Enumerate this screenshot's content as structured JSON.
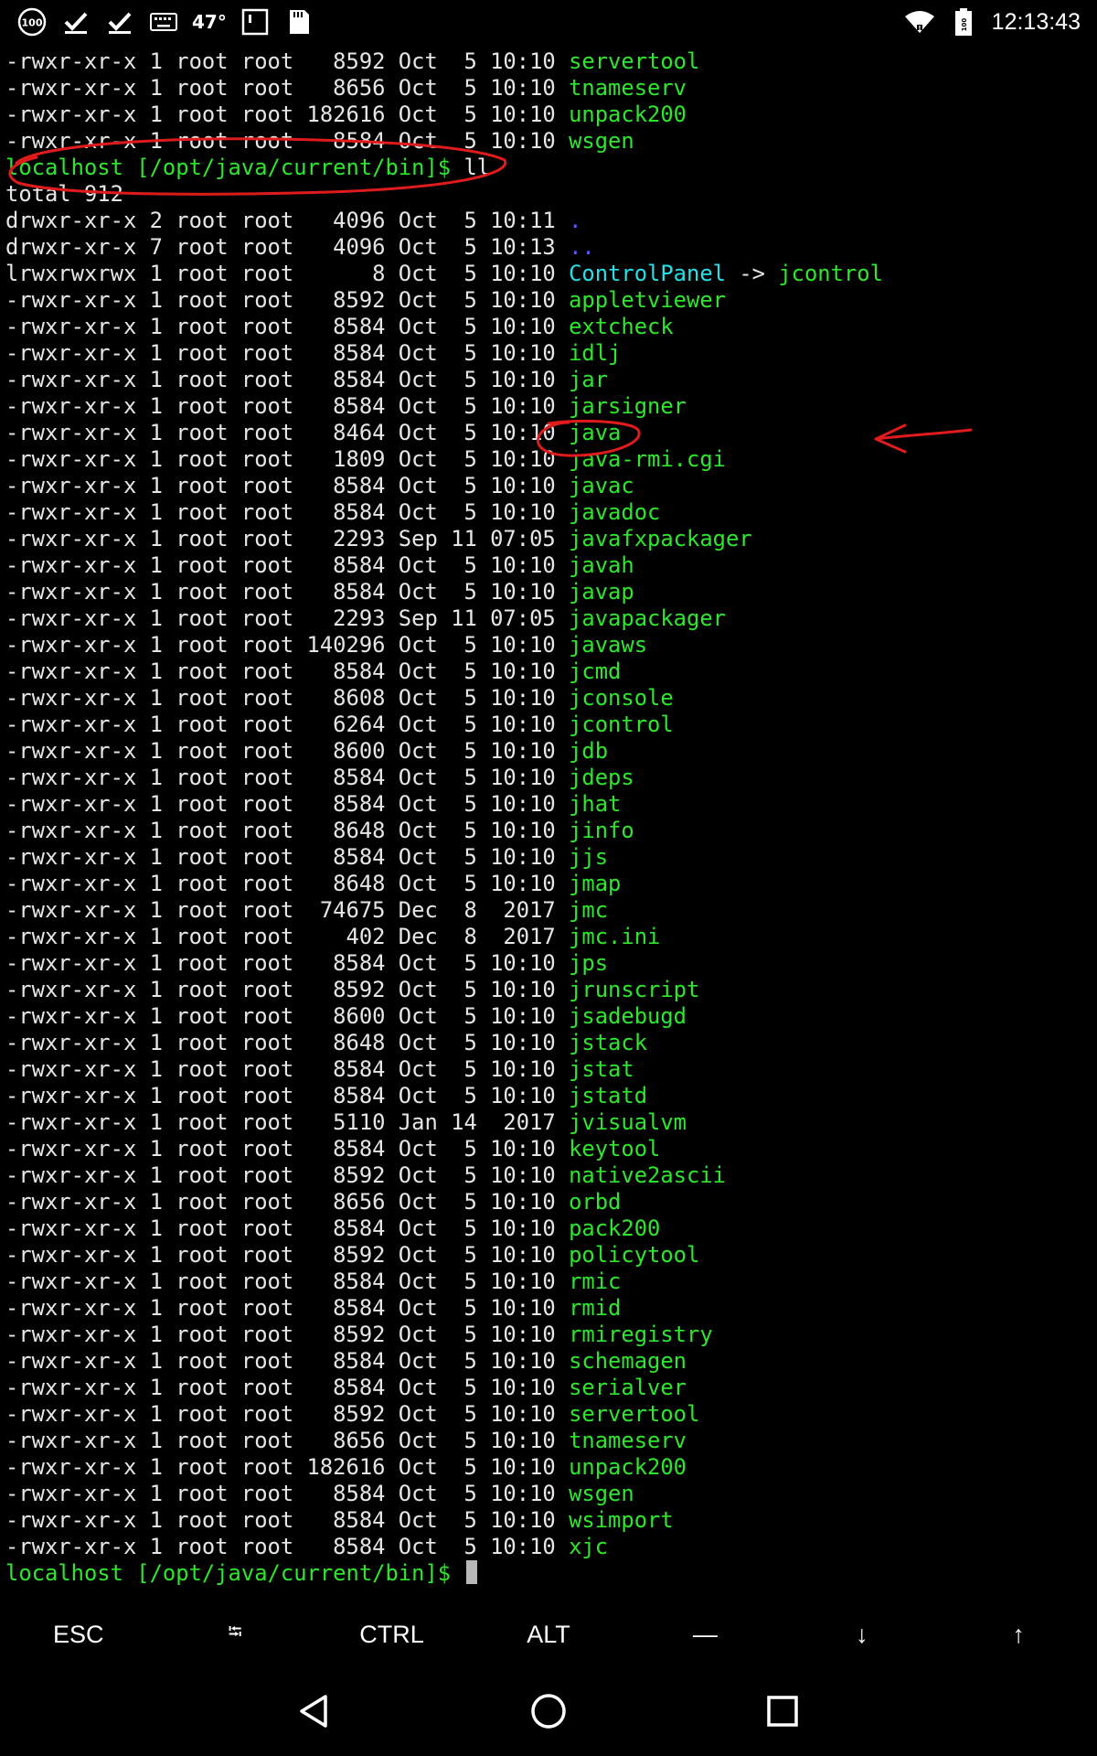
{
  "status_bar": {
    "left_icons": [
      "battery-100-circle-icon",
      "checkmark-icon",
      "checkmark-icon",
      "keyboard-icon"
    ],
    "temperature": "47°",
    "more_left_icons": [
      "notification-square-icon",
      "sd-card-icon"
    ],
    "right_icons": [
      "wifi-icon",
      "battery-icon"
    ],
    "time": "12:13:43"
  },
  "terminal": {
    "lines": [
      {
        "perm": "-rwxr-xr-x 1 root root   8592 Oct  5 10:10 ",
        "name": "servertool",
        "type": "exec"
      },
      {
        "perm": "-rwxr-xr-x 1 root root   8656 Oct  5 10:10 ",
        "name": "tnameserv",
        "type": "exec"
      },
      {
        "perm": "-rwxr-xr-x 1 root root 182616 Oct  5 10:10 ",
        "name": "unpack200",
        "type": "exec"
      },
      {
        "perm": "-rwxr-xr-x 1 root root   8584 Oct  5 10:10 ",
        "name": "wsgen",
        "type": "exec"
      },
      {
        "type": "prompt",
        "prompt": "localhost [/opt/java/current/bin]$",
        "cmd": " ll"
      },
      {
        "perm": "total 912",
        "name": "",
        "type": "plain"
      },
      {
        "perm": "drwxr-xr-x 2 root root   4096 Oct  5 10:11 ",
        "name": ".",
        "type": "dir"
      },
      {
        "perm": "drwxr-xr-x 7 root root   4096 Oct  5 10:13 ",
        "name": "..",
        "type": "dir"
      },
      {
        "perm": "lrwxrwxrwx 1 root root      8 Oct  5 10:10 ",
        "name": "ControlPanel",
        "type": "link",
        "arrow": " -> ",
        "target": "jcontrol"
      },
      {
        "perm": "-rwxr-xr-x 1 root root   8592 Oct  5 10:10 ",
        "name": "appletviewer",
        "type": "exec"
      },
      {
        "perm": "-rwxr-xr-x 1 root root   8584 Oct  5 10:10 ",
        "name": "extcheck",
        "type": "exec"
      },
      {
        "perm": "-rwxr-xr-x 1 root root   8584 Oct  5 10:10 ",
        "name": "idlj",
        "type": "exec"
      },
      {
        "perm": "-rwxr-xr-x 1 root root   8584 Oct  5 10:10 ",
        "name": "jar",
        "type": "exec"
      },
      {
        "perm": "-rwxr-xr-x 1 root root   8584 Oct  5 10:10 ",
        "name": "jarsigner",
        "type": "exec"
      },
      {
        "perm": "-rwxr-xr-x 1 root root   8464 Oct  5 10:10 ",
        "name": "java",
        "type": "exec"
      },
      {
        "perm": "-rwxr-xr-x 1 root root   1809 Oct  5 10:10 ",
        "name": "java-rmi.cgi",
        "type": "exec"
      },
      {
        "perm": "-rwxr-xr-x 1 root root   8584 Oct  5 10:10 ",
        "name": "javac",
        "type": "exec"
      },
      {
        "perm": "-rwxr-xr-x 1 root root   8584 Oct  5 10:10 ",
        "name": "javadoc",
        "type": "exec"
      },
      {
        "perm": "-rwxr-xr-x 1 root root   2293 Sep 11 07:05 ",
        "name": "javafxpackager",
        "type": "exec"
      },
      {
        "perm": "-rwxr-xr-x 1 root root   8584 Oct  5 10:10 ",
        "name": "javah",
        "type": "exec"
      },
      {
        "perm": "-rwxr-xr-x 1 root root   8584 Oct  5 10:10 ",
        "name": "javap",
        "type": "exec"
      },
      {
        "perm": "-rwxr-xr-x 1 root root   2293 Sep 11 07:05 ",
        "name": "javapackager",
        "type": "exec"
      },
      {
        "perm": "-rwxr-xr-x 1 root root 140296 Oct  5 10:10 ",
        "name": "javaws",
        "type": "exec"
      },
      {
        "perm": "-rwxr-xr-x 1 root root   8584 Oct  5 10:10 ",
        "name": "jcmd",
        "type": "exec"
      },
      {
        "perm": "-rwxr-xr-x 1 root root   8608 Oct  5 10:10 ",
        "name": "jconsole",
        "type": "exec"
      },
      {
        "perm": "-rwxr-xr-x 1 root root   6264 Oct  5 10:10 ",
        "name": "jcontrol",
        "type": "exec"
      },
      {
        "perm": "-rwxr-xr-x 1 root root   8600 Oct  5 10:10 ",
        "name": "jdb",
        "type": "exec"
      },
      {
        "perm": "-rwxr-xr-x 1 root root   8584 Oct  5 10:10 ",
        "name": "jdeps",
        "type": "exec"
      },
      {
        "perm": "-rwxr-xr-x 1 root root   8584 Oct  5 10:10 ",
        "name": "jhat",
        "type": "exec"
      },
      {
        "perm": "-rwxr-xr-x 1 root root   8648 Oct  5 10:10 ",
        "name": "jinfo",
        "type": "exec"
      },
      {
        "perm": "-rwxr-xr-x 1 root root   8584 Oct  5 10:10 ",
        "name": "jjs",
        "type": "exec"
      },
      {
        "perm": "-rwxr-xr-x 1 root root   8648 Oct  5 10:10 ",
        "name": "jmap",
        "type": "exec"
      },
      {
        "perm": "-rwxr-xr-x 1 root root  74675 Dec  8  2017 ",
        "name": "jmc",
        "type": "exec"
      },
      {
        "perm": "-rwxr-xr-x 1 root root    402 Dec  8  2017 ",
        "name": "jmc.ini",
        "type": "exec"
      },
      {
        "perm": "-rwxr-xr-x 1 root root   8584 Oct  5 10:10 ",
        "name": "jps",
        "type": "exec"
      },
      {
        "perm": "-rwxr-xr-x 1 root root   8592 Oct  5 10:10 ",
        "name": "jrunscript",
        "type": "exec"
      },
      {
        "perm": "-rwxr-xr-x 1 root root   8600 Oct  5 10:10 ",
        "name": "jsadebugd",
        "type": "exec"
      },
      {
        "perm": "-rwxr-xr-x 1 root root   8648 Oct  5 10:10 ",
        "name": "jstack",
        "type": "exec"
      },
      {
        "perm": "-rwxr-xr-x 1 root root   8584 Oct  5 10:10 ",
        "name": "jstat",
        "type": "exec"
      },
      {
        "perm": "-rwxr-xr-x 1 root root   8584 Oct  5 10:10 ",
        "name": "jstatd",
        "type": "exec"
      },
      {
        "perm": "-rwxr-xr-x 1 root root   5110 Jan 14  2017 ",
        "name": "jvisualvm",
        "type": "exec"
      },
      {
        "perm": "-rwxr-xr-x 1 root root   8584 Oct  5 10:10 ",
        "name": "keytool",
        "type": "exec"
      },
      {
        "perm": "-rwxr-xr-x 1 root root   8592 Oct  5 10:10 ",
        "name": "native2ascii",
        "type": "exec"
      },
      {
        "perm": "-rwxr-xr-x 1 root root   8656 Oct  5 10:10 ",
        "name": "orbd",
        "type": "exec"
      },
      {
        "perm": "-rwxr-xr-x 1 root root   8584 Oct  5 10:10 ",
        "name": "pack200",
        "type": "exec"
      },
      {
        "perm": "-rwxr-xr-x 1 root root   8592 Oct  5 10:10 ",
        "name": "policytool",
        "type": "exec"
      },
      {
        "perm": "-rwxr-xr-x 1 root root   8584 Oct  5 10:10 ",
        "name": "rmic",
        "type": "exec"
      },
      {
        "perm": "-rwxr-xr-x 1 root root   8584 Oct  5 10:10 ",
        "name": "rmid",
        "type": "exec"
      },
      {
        "perm": "-rwxr-xr-x 1 root root   8592 Oct  5 10:10 ",
        "name": "rmiregistry",
        "type": "exec"
      },
      {
        "perm": "-rwxr-xr-x 1 root root   8584 Oct  5 10:10 ",
        "name": "schemagen",
        "type": "exec"
      },
      {
        "perm": "-rwxr-xr-x 1 root root   8584 Oct  5 10:10 ",
        "name": "serialver",
        "type": "exec"
      },
      {
        "perm": "-rwxr-xr-x 1 root root   8592 Oct  5 10:10 ",
        "name": "servertool",
        "type": "exec"
      },
      {
        "perm": "-rwxr-xr-x 1 root root   8656 Oct  5 10:10 ",
        "name": "tnameserv",
        "type": "exec"
      },
      {
        "perm": "-rwxr-xr-x 1 root root 182616 Oct  5 10:10 ",
        "name": "unpack200",
        "type": "exec"
      },
      {
        "perm": "-rwxr-xr-x 1 root root   8584 Oct  5 10:10 ",
        "name": "wsgen",
        "type": "exec"
      },
      {
        "perm": "-rwxr-xr-x 1 root root   8584 Oct  5 10:10 ",
        "name": "wsimport",
        "type": "exec"
      },
      {
        "perm": "-rwxr-xr-x 1 root root   8584 Oct  5 10:10 ",
        "name": "xjc",
        "type": "exec"
      },
      {
        "type": "prompt",
        "prompt": "localhost [/opt/java/current/bin]$",
        "cmd": " ",
        "cursor": true
      }
    ]
  },
  "extra_keys": [
    {
      "label": "ESC",
      "name": "esc-key"
    },
    {
      "label": "⭾",
      "name": "tab-key"
    },
    {
      "label": "CTRL",
      "name": "ctrl-key"
    },
    {
      "label": "ALT",
      "name": "alt-key"
    },
    {
      "label": "—",
      "name": "dash-key"
    },
    {
      "label": "↓",
      "name": "arrow-down-key"
    },
    {
      "label": "↑",
      "name": "arrow-up-key"
    }
  ],
  "nav_bar": [
    "back-nav-icon",
    "home-nav-icon",
    "recents-nav-icon"
  ],
  "colors": {
    "exec": "#2ee62e",
    "dir": "#5a5aff",
    "link": "#27e0e8",
    "annotation": "#e01b1b"
  }
}
